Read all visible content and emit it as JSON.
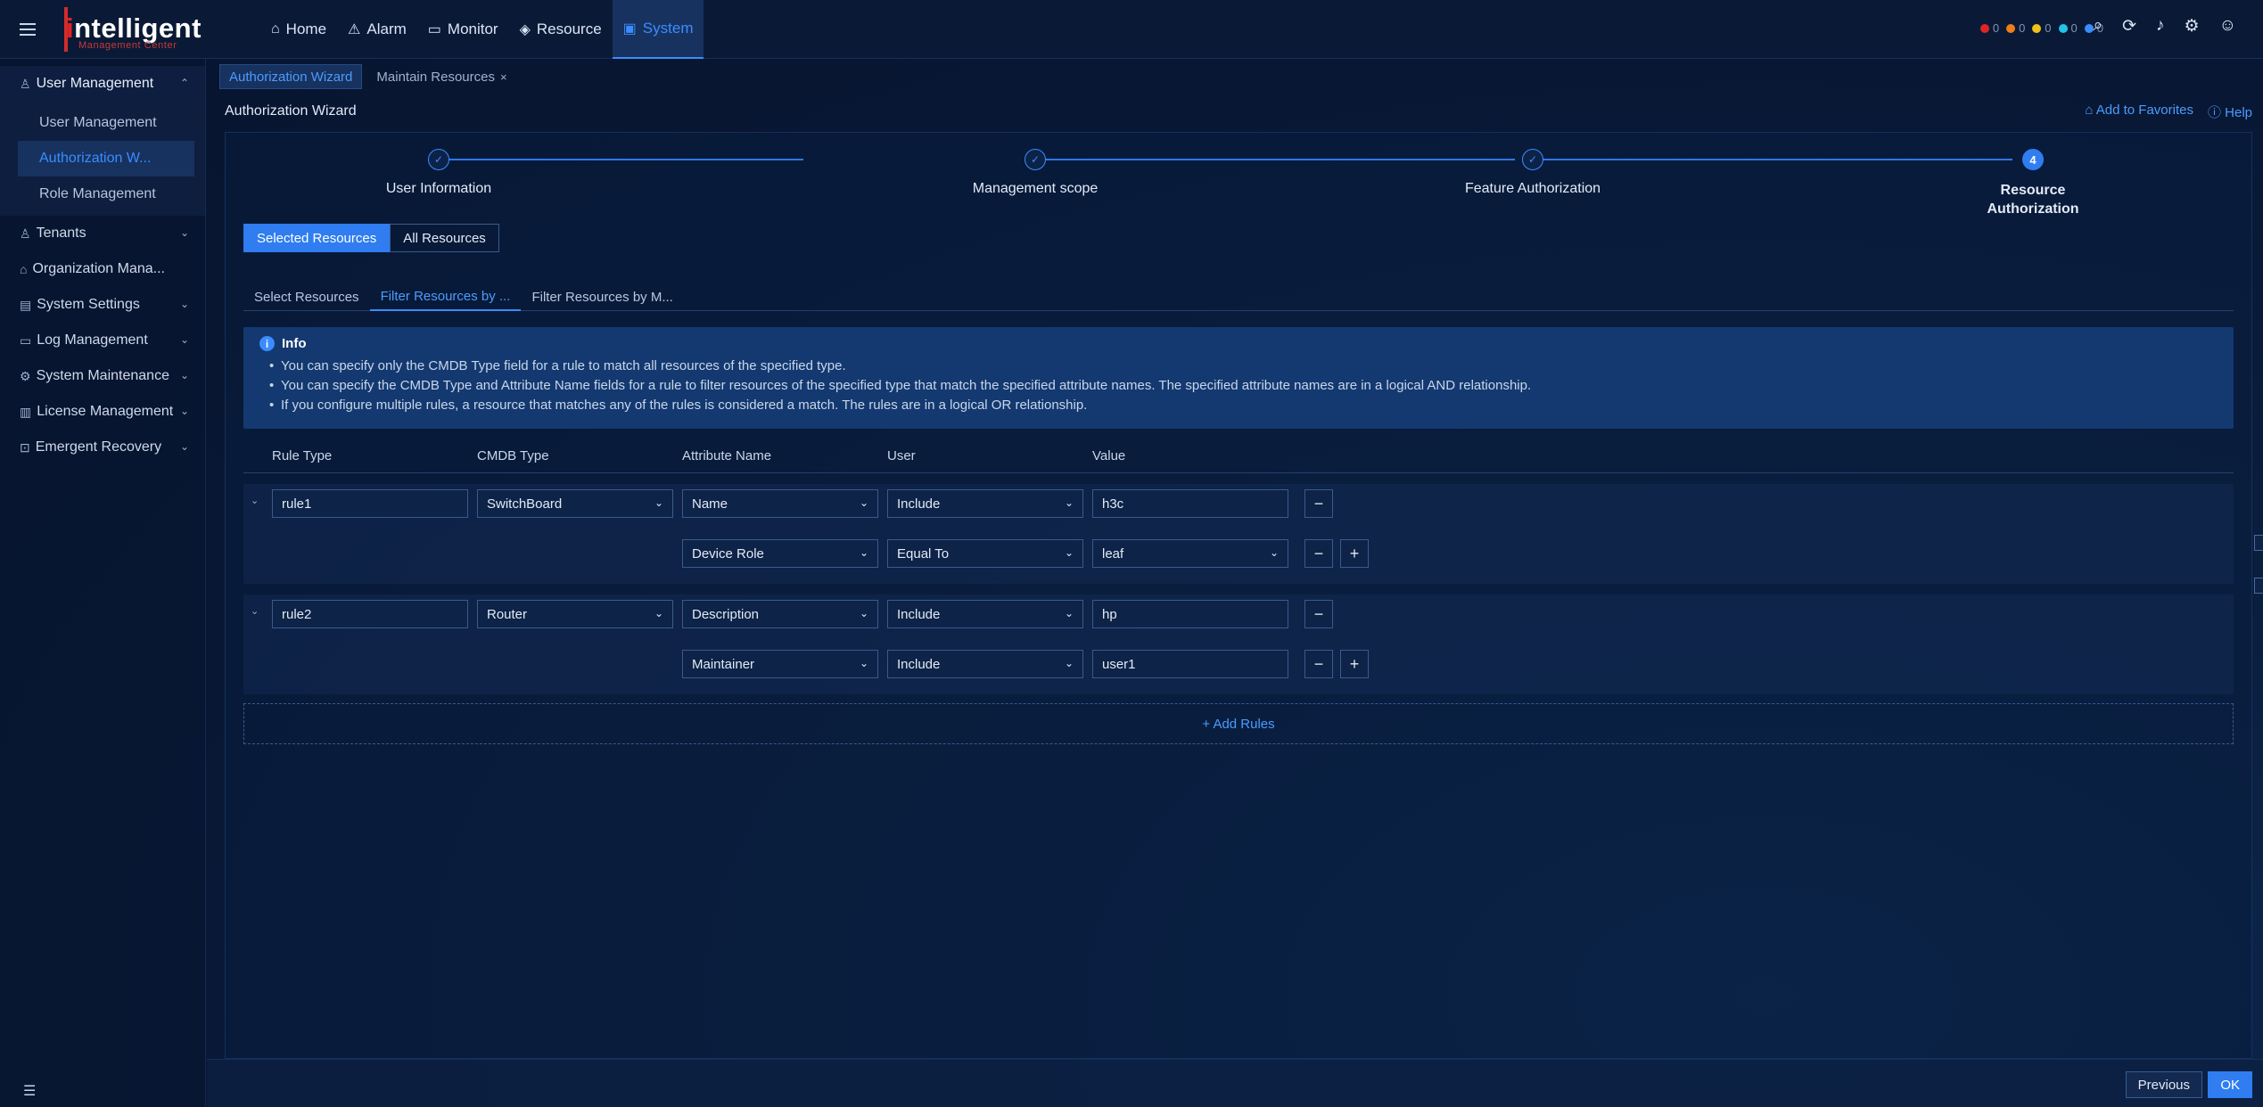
{
  "brand": {
    "logo_main_prefix": "ntelligent",
    "logo_main_dot": "i",
    "logo_sub": "Management Center"
  },
  "topnav": [
    {
      "label": "Home",
      "icon": "home-icon",
      "glyph": "⌂"
    },
    {
      "label": "Alarm",
      "icon": "alarm-icon",
      "glyph": "⚠"
    },
    {
      "label": "Monitor",
      "icon": "monitor-icon",
      "glyph": "▭"
    },
    {
      "label": "Resource",
      "icon": "resource-icon",
      "glyph": "◈"
    },
    {
      "label": "System",
      "icon": "system-icon",
      "glyph": "▣"
    }
  ],
  "status_counts": [
    {
      "color": "#e02424",
      "value": "0"
    },
    {
      "color": "#f07c1a",
      "value": "0"
    },
    {
      "color": "#f0c21a",
      "value": "0"
    },
    {
      "color": "#22c3e6",
      "value": "0"
    },
    {
      "color": "#3b8cff",
      "value": "0"
    }
  ],
  "sidebar": {
    "groups": [
      {
        "label": "User Management",
        "icon": "user-icon",
        "chev": "⌃",
        "open": true,
        "items": [
          {
            "label": "User Management"
          },
          {
            "label": "Authorization W..."
          },
          {
            "label": "Role Management"
          }
        ]
      },
      {
        "label": "Tenants",
        "icon": "tenant-icon",
        "chev": "⌄"
      },
      {
        "label": "Organization Mana...",
        "icon": "org-icon",
        "chev": ""
      },
      {
        "label": "System Settings",
        "icon": "settings-icon",
        "chev": "⌄"
      },
      {
        "label": "Log Management",
        "icon": "log-icon",
        "chev": "⌄"
      },
      {
        "label": "System Maintenance",
        "icon": "maintenance-icon",
        "chev": "⌄"
      },
      {
        "label": "License Management",
        "icon": "license-icon",
        "chev": "⌄"
      },
      {
        "label": "Emergent Recovery",
        "icon": "recovery-icon",
        "chev": "⌄"
      }
    ]
  },
  "page_tabs": [
    {
      "label": "Authorization Wizard"
    },
    {
      "label": "Maintain Resources",
      "close": "×"
    }
  ],
  "page_title": "Authorization Wizard",
  "top_links": {
    "favorites": "Add to Favorites",
    "help": "Help"
  },
  "steps": [
    {
      "label": "User Information",
      "mark": "✓"
    },
    {
      "label": "Management scope",
      "mark": "✓"
    },
    {
      "label": "Feature Authorization",
      "mark": "✓"
    },
    {
      "label": "Resource Authorization",
      "mark": "4"
    }
  ],
  "resource_toggle": {
    "selected": "Selected Resources",
    "all": "All Resources"
  },
  "sub_tabs": [
    "Select Resources",
    "Filter Resources by ...",
    "Filter Resources by M..."
  ],
  "info": {
    "title": "Info",
    "lines": [
      "You can specify only the CMDB Type field for a rule to match all resources of the specified type.",
      "You can specify the CMDB Type and Attribute Name fields for a rule to filter resources of the specified type that match the specified attribute names. The specified attribute names are in a logical AND relationship.",
      "If you configure multiple rules, a resource that matches any of the rules is considered a match. The rules are in a logical OR relationship."
    ]
  },
  "columns": {
    "rule_type": "Rule Type",
    "cmdb_type": "CMDB Type",
    "attribute": "Attribute Name",
    "user": "User",
    "value": "Value"
  },
  "rules": [
    {
      "name": "rule1",
      "cmdb_type": "SwitchBoard",
      "conditions": [
        {
          "attribute": "Name",
          "user": "Include",
          "value": "h3c",
          "value_dropdown": false
        },
        {
          "attribute": "Device Role",
          "user": "Equal To",
          "value": "leaf",
          "value_dropdown": true
        }
      ]
    },
    {
      "name": "rule2",
      "cmdb_type": "Router",
      "conditions": [
        {
          "attribute": "Description",
          "user": "Include",
          "value": "hp",
          "value_dropdown": false
        },
        {
          "attribute": "Maintainer",
          "user": "Include",
          "value": "user1",
          "value_dropdown": false
        }
      ]
    }
  ],
  "add_rules": "+ Add Rules",
  "footer": {
    "previous": "Previous",
    "ok": "OK"
  }
}
